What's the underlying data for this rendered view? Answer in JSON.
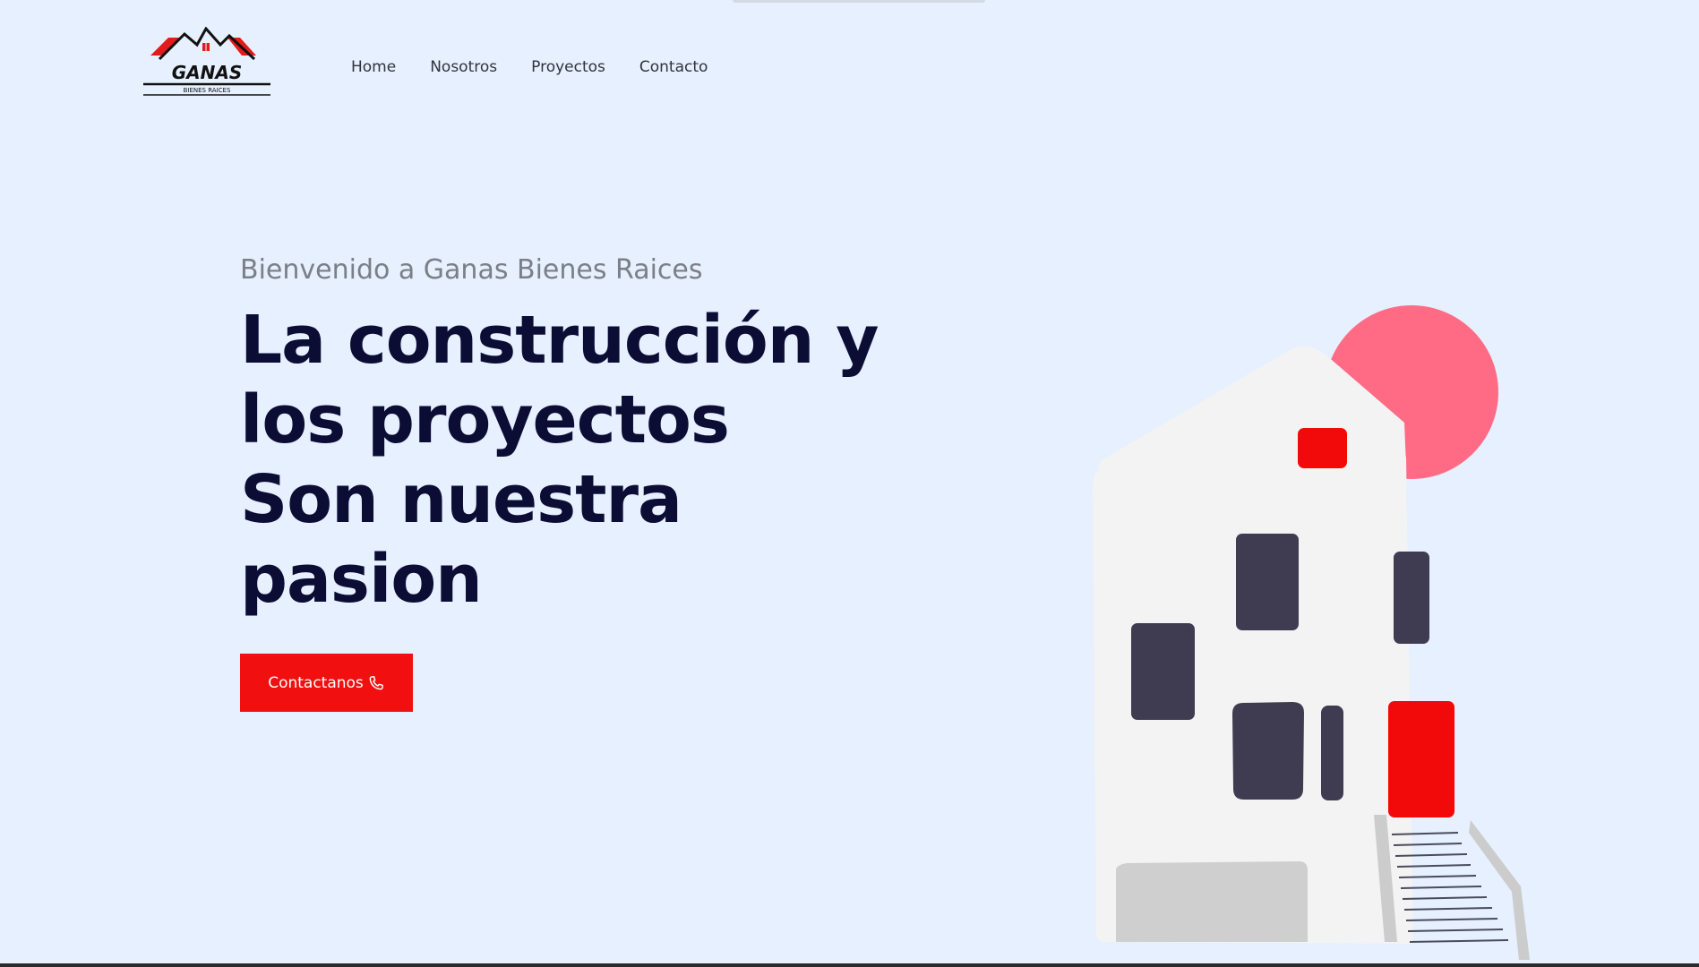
{
  "brand": {
    "logo_text": "GANAS",
    "logo_subtext": "BIENES RAICES"
  },
  "nav": {
    "items": [
      {
        "label": "Home"
      },
      {
        "label": "Nosotros"
      },
      {
        "label": "Proyectos"
      },
      {
        "label": "Contacto"
      }
    ]
  },
  "hero": {
    "welcome": "Bienvenido a Ganas Bienes Raices",
    "headline_lines": [
      "La construcción y",
      "los proyectos",
      "Son nuestra",
      "pasion"
    ],
    "cta_label": "Contactanos",
    "cta_icon": "phone-icon"
  },
  "colors": {
    "background": "#e6f0fe",
    "accent": "#f10f0f",
    "headline": "#0b0d35",
    "sun": "#ff6b85"
  }
}
